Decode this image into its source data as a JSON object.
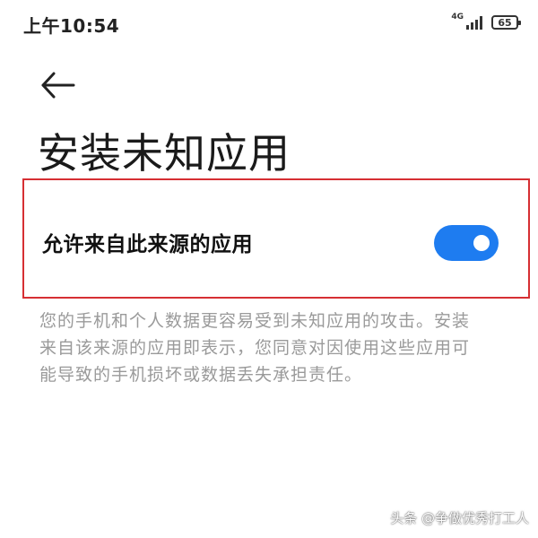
{
  "status_bar": {
    "time": "上午10:54",
    "network_label": "4G",
    "signal_icon": "signal-strength-icon",
    "battery_level": "65",
    "battery_icon": "battery-icon"
  },
  "header": {
    "back_icon": "arrow-left-icon",
    "title": "安装未知应用"
  },
  "setting": {
    "label": "允许来自此来源的应用",
    "toggle_state": "on",
    "toggle_color": "#1e7cf0",
    "highlight_border_color": "#d62f33"
  },
  "description": "您的手机和个人数据更容易受到未知应用的攻击。安装来自该来源的应用即表示，您同意对因使用这些应用可能导致的手机损坏或数据丢失承担责任。",
  "watermark": "头条 @争做优秀打工人"
}
